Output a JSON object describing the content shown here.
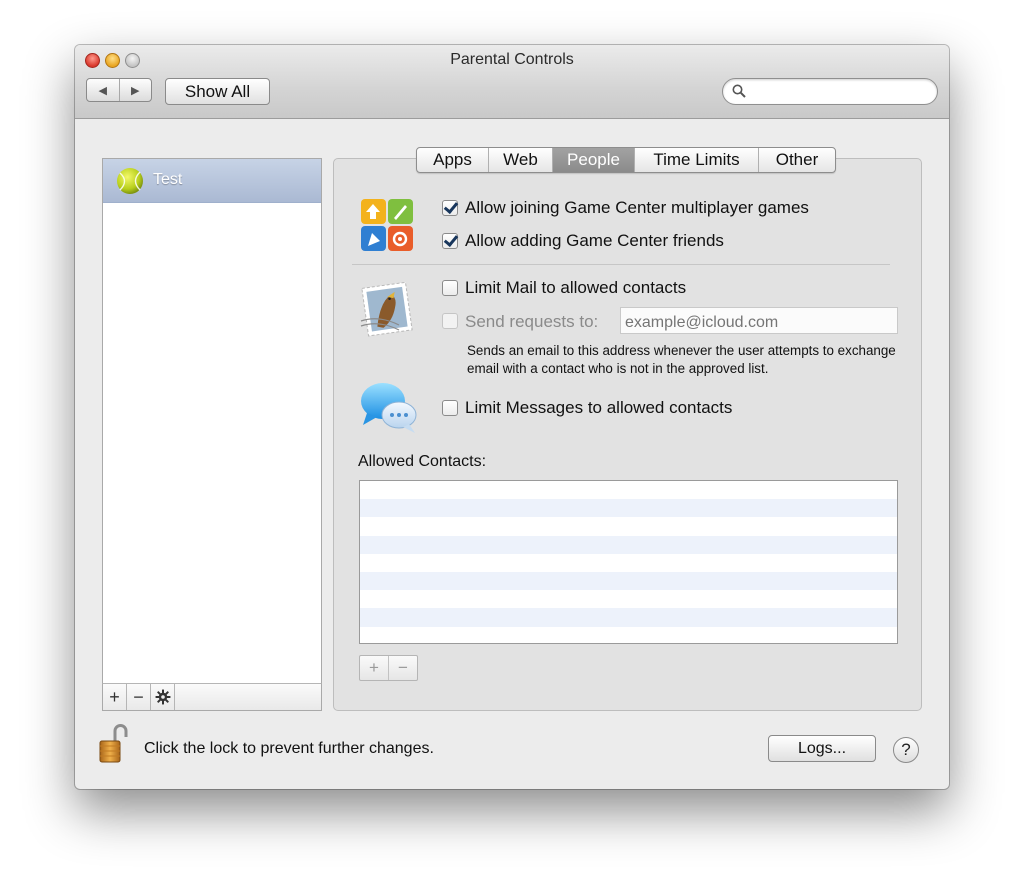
{
  "window": {
    "title": "Parental Controls"
  },
  "toolbar": {
    "back_glyph": "◀",
    "forward_glyph": "▶",
    "show_all_label": "Show All",
    "search": {
      "value": "",
      "placeholder": ""
    }
  },
  "users": {
    "items": [
      {
        "name": "Test",
        "selected": true
      }
    ],
    "actions": {
      "add": "+",
      "remove": "−",
      "settings_icon": "gear-icon"
    }
  },
  "tabs": [
    {
      "label": "Apps",
      "active": false
    },
    {
      "label": "Web",
      "active": false
    },
    {
      "label": "People",
      "active": true
    },
    {
      "label": "Time Limits",
      "active": false
    },
    {
      "label": "Other",
      "active": false
    }
  ],
  "game_center": {
    "icon": "game-center-icon",
    "allow_multiplayer": {
      "label": "Allow joining Game Center multiplayer games",
      "checked": true
    },
    "allow_friends": {
      "label": "Allow adding Game Center friends",
      "checked": true
    }
  },
  "mail": {
    "icon": "mail-stamp-icon",
    "limit": {
      "label": "Limit Mail to allowed contacts",
      "checked": false
    },
    "send_requests": {
      "label": "Send requests to:",
      "checked": false,
      "enabled": false
    },
    "email": {
      "value": "",
      "placeholder": "example@icloud.com"
    },
    "note": "Sends an email to this address whenever the user attempts to exchange email with a contact who is not in the approved list."
  },
  "messages": {
    "icon": "messages-icon",
    "limit": {
      "label": "Limit Messages to allowed contacts",
      "checked": false
    }
  },
  "allowed_contacts": {
    "title": "Allowed Contacts:",
    "rows": [],
    "add": "+",
    "remove": "−"
  },
  "footer": {
    "lock_icon": "open-lock-icon",
    "lock_text": "Click the lock to prevent further changes.",
    "logs_label": "Logs...",
    "help_label": "?"
  },
  "colors": {
    "selection": "#aab9d3",
    "active_tab": "#8b8b8b",
    "check_mark": "#18365c",
    "stripe": "#edf2fb"
  }
}
